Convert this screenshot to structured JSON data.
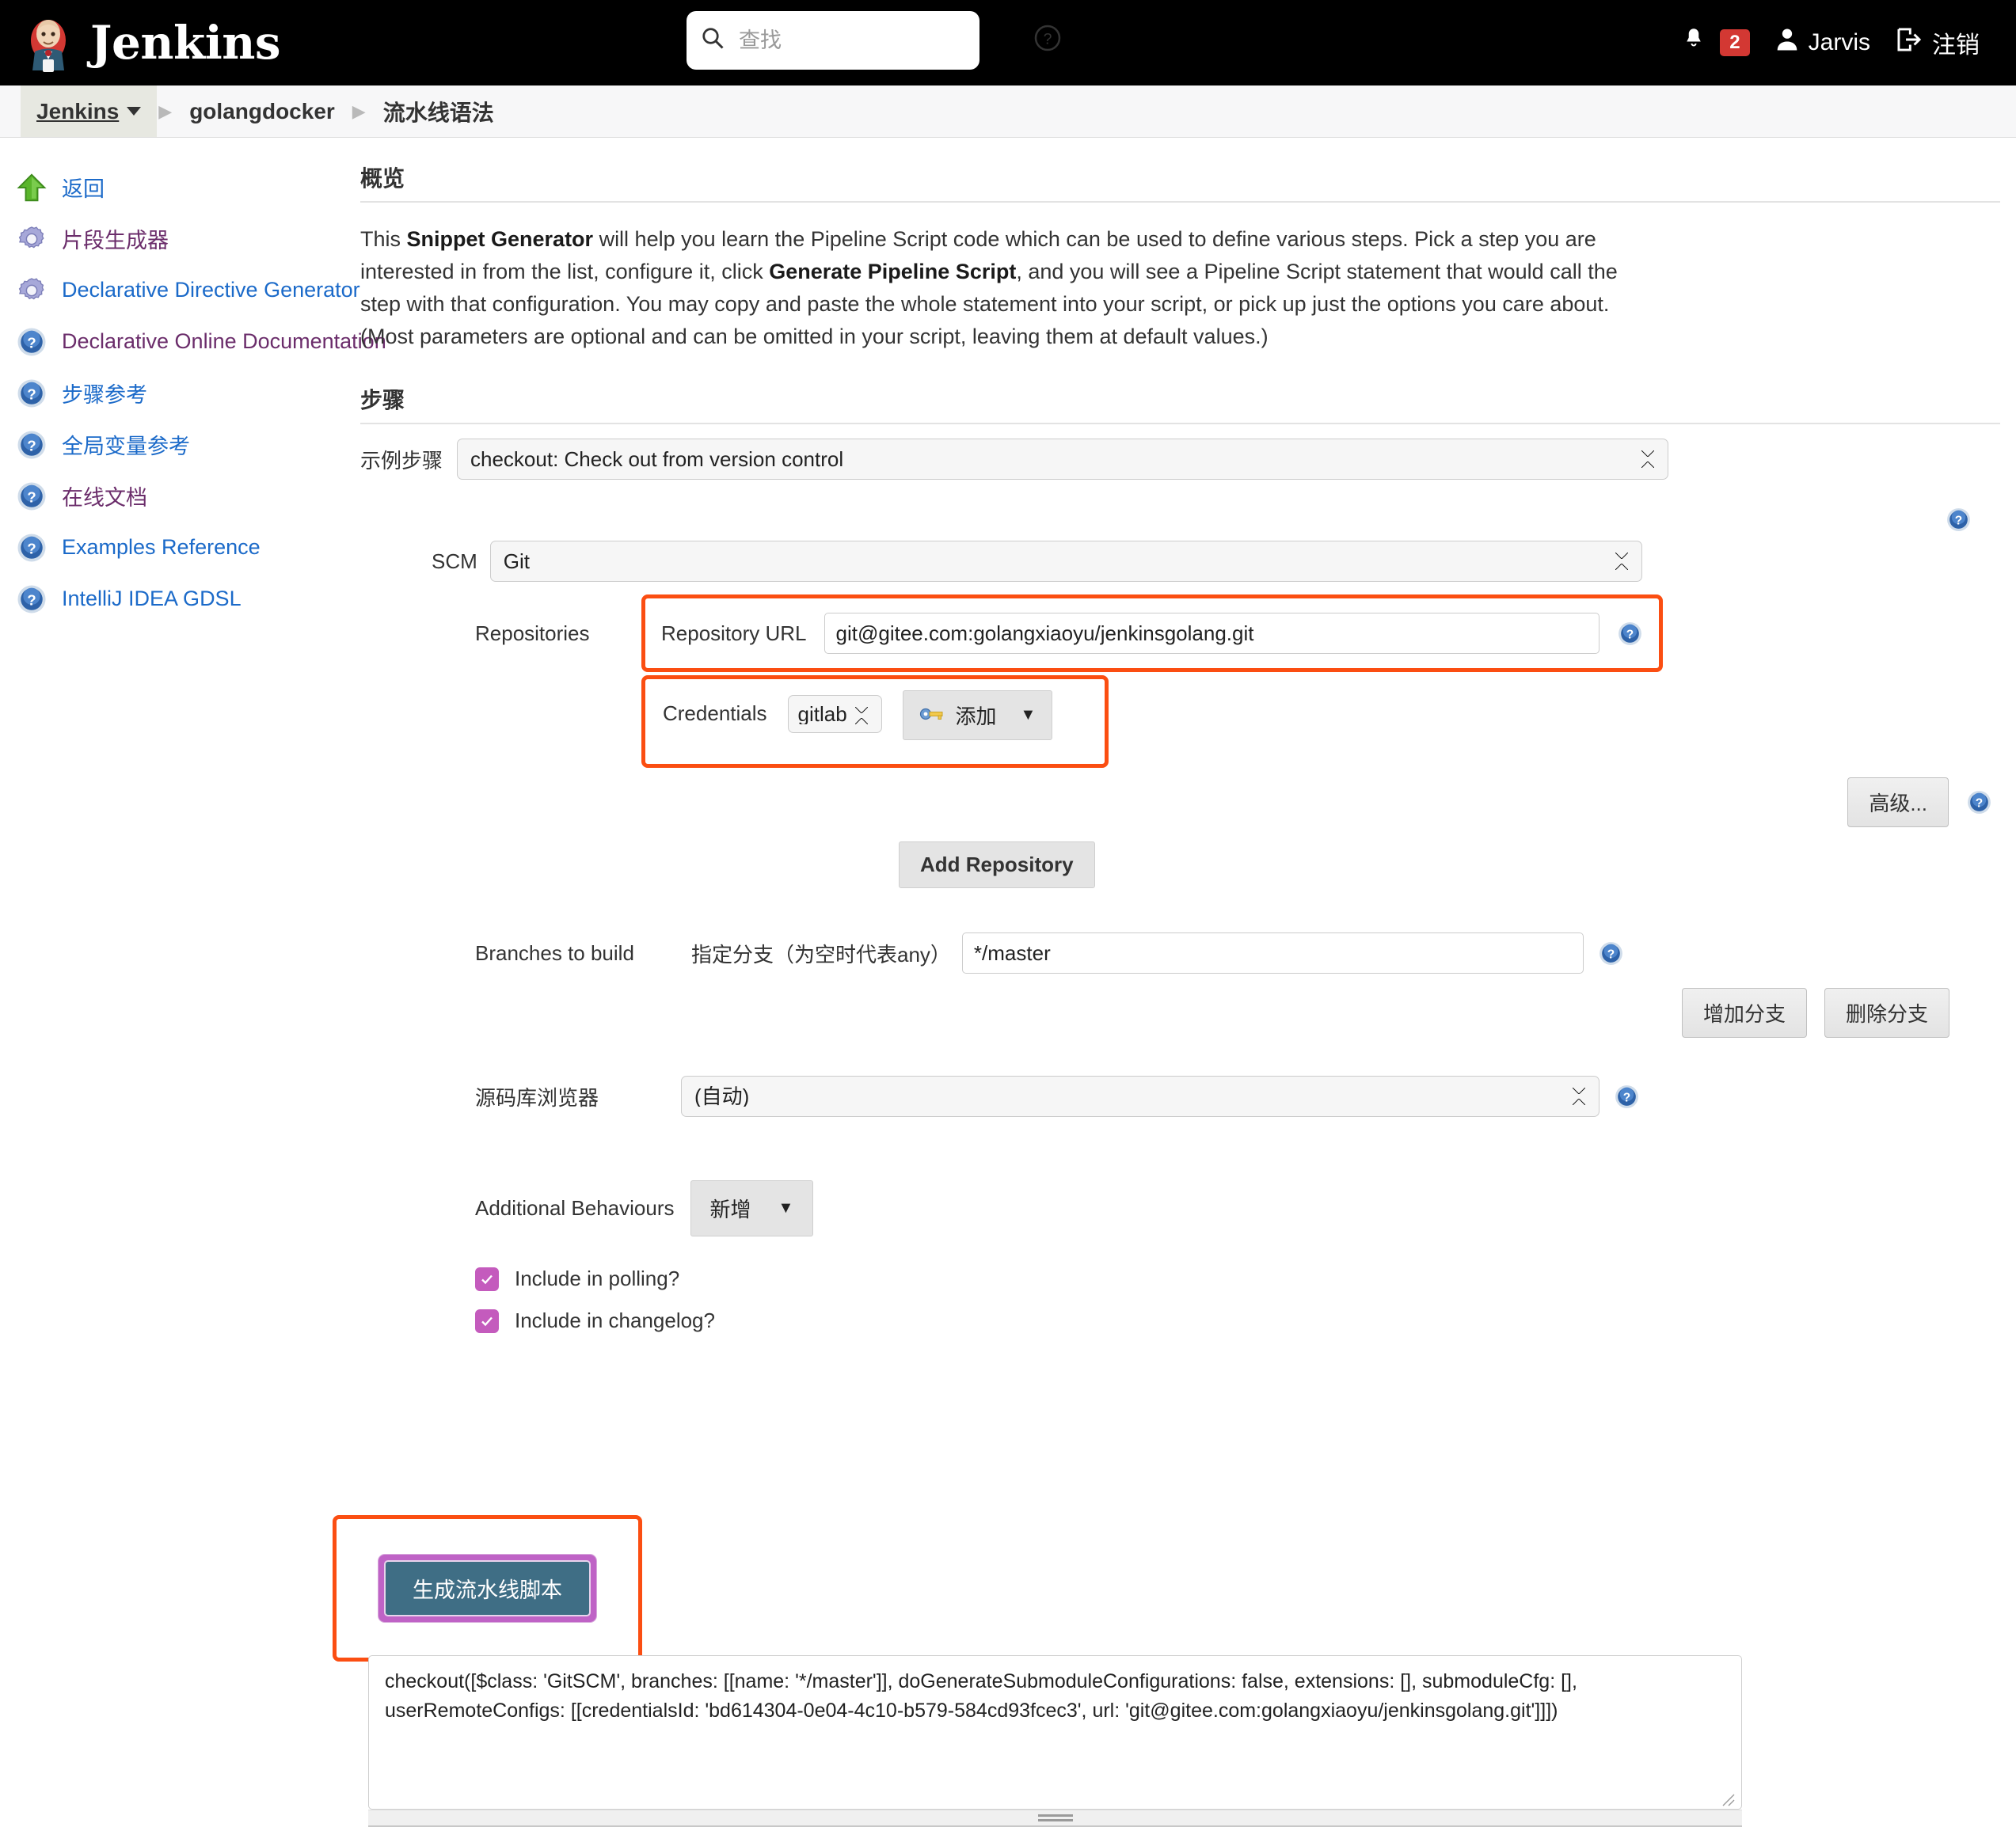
{
  "header": {
    "brand": "Jenkins",
    "search_placeholder": "查找",
    "search_value": "",
    "help_icon": "question-circle-icon",
    "notification_icon": "bell-icon",
    "notification_count": "2",
    "user_icon": "person-icon",
    "user_name": "Jarvis",
    "logout_icon": "logout-icon",
    "logout_label": "注销"
  },
  "breadcrumb": {
    "items": [
      {
        "label": "Jenkins",
        "has_caret": true
      },
      {
        "label": "golangdocker",
        "has_caret": false
      },
      {
        "label": "流水线语法",
        "has_caret": false
      }
    ]
  },
  "sidebar": {
    "items": [
      {
        "label": "返回",
        "icon": "up-arrow-icon",
        "color": "#1b6ac9"
      },
      {
        "label": "片段生成器",
        "icon": "gear-icon",
        "color": "#6b2d6b"
      },
      {
        "label": "Declarative Directive Generator",
        "icon": "gear-icon",
        "color": "#1b6ac9"
      },
      {
        "label": "Declarative Online Documentation",
        "icon": "help-icon",
        "color": "#6b2d6b"
      },
      {
        "label": "步骤参考",
        "icon": "help-icon",
        "color": "#1b6ac9"
      },
      {
        "label": "全局变量参考",
        "icon": "help-icon",
        "color": "#1b6ac9"
      },
      {
        "label": "在线文档",
        "icon": "help-icon",
        "color": "#6b2d6b"
      },
      {
        "label": "Examples Reference",
        "icon": "help-icon",
        "color": "#1b6ac9"
      },
      {
        "label": "IntelliJ IDEA GDSL",
        "icon": "help-icon",
        "color": "#1b6ac9"
      }
    ]
  },
  "overview": {
    "title": "概览",
    "text_1": "This ",
    "bold_1": "Snippet Generator",
    "text_2": " will help you learn the Pipeline Script code which can be used to define various steps. Pick a step you are interested in from the list, configure it, click ",
    "bold_2": "Generate Pipeline Script",
    "text_3": ", and you will see a Pipeline Script statement that would call the step with that configuration. You may copy and paste the whole statement into your script, or pick up just the options you care about. (Most parameters are optional and can be omitted in your script, leaving them at default values.)"
  },
  "steps": {
    "title": "步骤",
    "sample_step_label": "示例步骤",
    "sample_step_value": "checkout: Check out from version control"
  },
  "form": {
    "scm_label": "SCM",
    "scm_value": "Git",
    "repositories_label": "Repositories",
    "repository_url_label": "Repository URL",
    "repository_url_value": "git@gitee.com:golangxiaoyu/jenkinsgolang.git",
    "credentials_label": "Credentials",
    "credentials_value": "gitlab",
    "credentials_add_label": "添加",
    "credentials_add_icon": "key-icon",
    "advanced_label": "高级...",
    "add_repository_label": "Add Repository",
    "branches_label": "Branches to build",
    "branch_spec_label": "指定分支（为空时代表any）",
    "branch_spec_value": "*/master",
    "add_branch_label": "增加分支",
    "delete_branch_label": "删除分支",
    "repo_browser_label": "源码库浏览器",
    "repo_browser_value": "(自动)",
    "additional_behaviours_label": "Additional Behaviours",
    "additional_behaviours_add_label": "新增",
    "include_polling_label": "Include in polling?",
    "include_polling_checked": true,
    "include_changelog_label": "Include in changelog?",
    "include_changelog_checked": true
  },
  "generate": {
    "button_label": "生成流水线脚本",
    "script_output": "checkout([$class: 'GitSCM', branches: [[name: '*/master']], doGenerateSubmoduleConfigurations: false, extensions: [], submoduleCfg: [], userRemoteConfigs: [[credentialsId: 'bd614304-0e04-4c10-b579-584cd93fcec3', url: 'git@gitee.com:golangxiaoyu/jenkinsgolang.git']]])"
  },
  "colors": {
    "highlight": "#fb4e12",
    "accent_blue": "#1b6ac9",
    "visited_purple": "#6b2d6b",
    "checkbox": "#c45bbd",
    "badge_red": "#d33833"
  }
}
